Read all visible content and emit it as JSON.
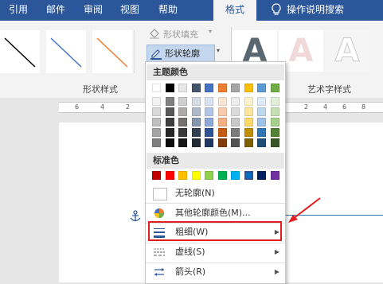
{
  "tabs": [
    "引用",
    "邮件",
    "审阅",
    "视图",
    "帮助",
    "格式",
    "操作说明搜索"
  ],
  "active_tab": "格式",
  "ribbon": {
    "shape_fill_label": "形状填充",
    "shape_outline_label": "形状轮廓",
    "group_shape_styles": "形状样式",
    "group_wordart_styles": "艺术字样式",
    "wordart_glyph": "A",
    "line_colors": [
      "#000000",
      "#4472c4",
      "#ed7d31"
    ]
  },
  "ruler": {
    "numbers": [
      "6",
      "4",
      "2",
      "2",
      "4",
      "6",
      "8"
    ]
  },
  "menu": {
    "theme_colors_header": "主题颜色",
    "standard_colors_header": "标准色",
    "theme_top_row": [
      "#ffffff",
      "#000000",
      "#e7e6e6",
      "#44546a",
      "#4472c4",
      "#ed7d31",
      "#a5a5a5",
      "#ffc000",
      "#5b9bd5",
      "#70ad47"
    ],
    "theme_shades": [
      [
        "#f2f2f2",
        "#7f7f7f",
        "#d0cece",
        "#d6dce4",
        "#d9e2f3",
        "#fbe5d5",
        "#ededed",
        "#fff2cc",
        "#deebf6",
        "#e2efd9"
      ],
      [
        "#d8d8d8",
        "#595959",
        "#aeabab",
        "#adb9ca",
        "#b4c6e7",
        "#f7cbac",
        "#dbdbdb",
        "#fee599",
        "#bdd7ee",
        "#c5e0b3"
      ],
      [
        "#bfbfbf",
        "#3f3f3f",
        "#757070",
        "#8496b0",
        "#8eaadb",
        "#f4b183",
        "#c9c9c9",
        "#ffd966",
        "#9cc3e5",
        "#a8d08d"
      ],
      [
        "#a5a5a5",
        "#262626",
        "#3a3838",
        "#323f4f",
        "#2f5496",
        "#c55a11",
        "#7b7b7b",
        "#bf8f00",
        "#2e75b5",
        "#538135"
      ],
      [
        "#7f7f7f",
        "#0c0c0c",
        "#171616",
        "#222a35",
        "#1f3864",
        "#833c0b",
        "#525252",
        "#7f6000",
        "#1e4e79",
        "#375623"
      ]
    ],
    "standard_colors": [
      "#c00000",
      "#ff0000",
      "#ffc000",
      "#ffff00",
      "#92d050",
      "#00b050",
      "#00b0f0",
      "#0070c0",
      "#002060",
      "#7030a0"
    ],
    "selected_standard_index": 7,
    "no_outline": "无轮廓(N)",
    "more_colors": "其他轮廓颜色(M)...",
    "weight": "粗细(W)",
    "dashes": "虚线(S)",
    "arrows": "箭头(R)"
  },
  "colors": {
    "accent": "#2b579a",
    "highlight": "#e02020"
  }
}
